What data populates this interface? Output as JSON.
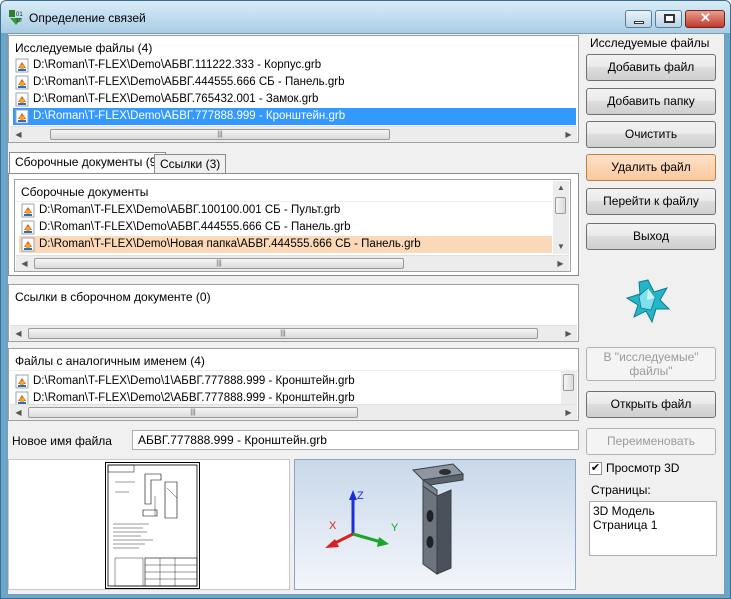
{
  "window": {
    "title": "Определение связей"
  },
  "studied_files": {
    "header": "Исследуемые файлы (4)",
    "items": [
      "D:\\Roman\\T-FLEX\\Demo\\АБВГ.111222.333 - Корпус.grb",
      "D:\\Roman\\T-FLEX\\Demo\\АБВГ.444555.666 СБ - Панель.grb",
      "D:\\Roman\\T-FLEX\\Demo\\АБВГ.765432.001 - Замок.grb",
      "D:\\Roman\\T-FLEX\\Demo\\АБВГ.777888.999 - Кронштейн.grb"
    ],
    "selected_index": 3
  },
  "tabs": [
    {
      "label": "Сборочные документы (9)"
    },
    {
      "label": "Ссылки (3)"
    }
  ],
  "assembly_docs": {
    "header": "Сборочные документы",
    "items": [
      "D:\\Roman\\T-FLEX\\Demo\\АБВГ.100100.001 СБ - Пульт.grb",
      "D:\\Roman\\T-FLEX\\Demo\\АБВГ.444555.666 СБ - Панель.grb",
      "D:\\Roman\\T-FLEX\\Demo\\Новая папка\\АБВГ.444555.666 СБ - Панель.grb"
    ],
    "highlighted_index": 2
  },
  "links_in_doc": {
    "header": "Ссылки в сборочном документе (0)"
  },
  "similar_files": {
    "header": "Файлы с аналогичным именем (4)",
    "items": [
      "D:\\Roman\\T-FLEX\\Demo\\1\\АБВГ.777888.999 - Кронштейн.grb",
      "D:\\Roman\\T-FLEX\\Demo\\2\\АБВГ.777888.999 - Кронштейн.grb"
    ]
  },
  "new_name": {
    "label": "Новое имя файла",
    "value": "АБВГ.777888.999 - Кронштейн.grb"
  },
  "side": {
    "group_title": "Исследуемые файлы",
    "add_file": "Добавить файл",
    "add_folder": "Добавить папку",
    "clear": "Очистить",
    "delete_file": "Удалить файл",
    "go_to_file": "Перейти к файлу",
    "exit": "Выход",
    "to_studied": "В \"исследуемые\"",
    "to_studied_2": "файлы\"",
    "open_file": "Открыть файл",
    "rename": "Переименовать",
    "preview_3d": "Просмотр 3D",
    "preview_3d_checked": true,
    "pages_label": "Страницы:",
    "pages": [
      "3D Модель",
      "Страница 1"
    ]
  },
  "preview3d": {
    "axes": {
      "x": "X",
      "y": "Y",
      "z": "Z"
    }
  },
  "colors": {
    "selection": "#3399ff",
    "highlight": "#fbd9b8",
    "viewport_top": "#c9d8ea",
    "viewport_bottom": "#f3f6fb"
  }
}
